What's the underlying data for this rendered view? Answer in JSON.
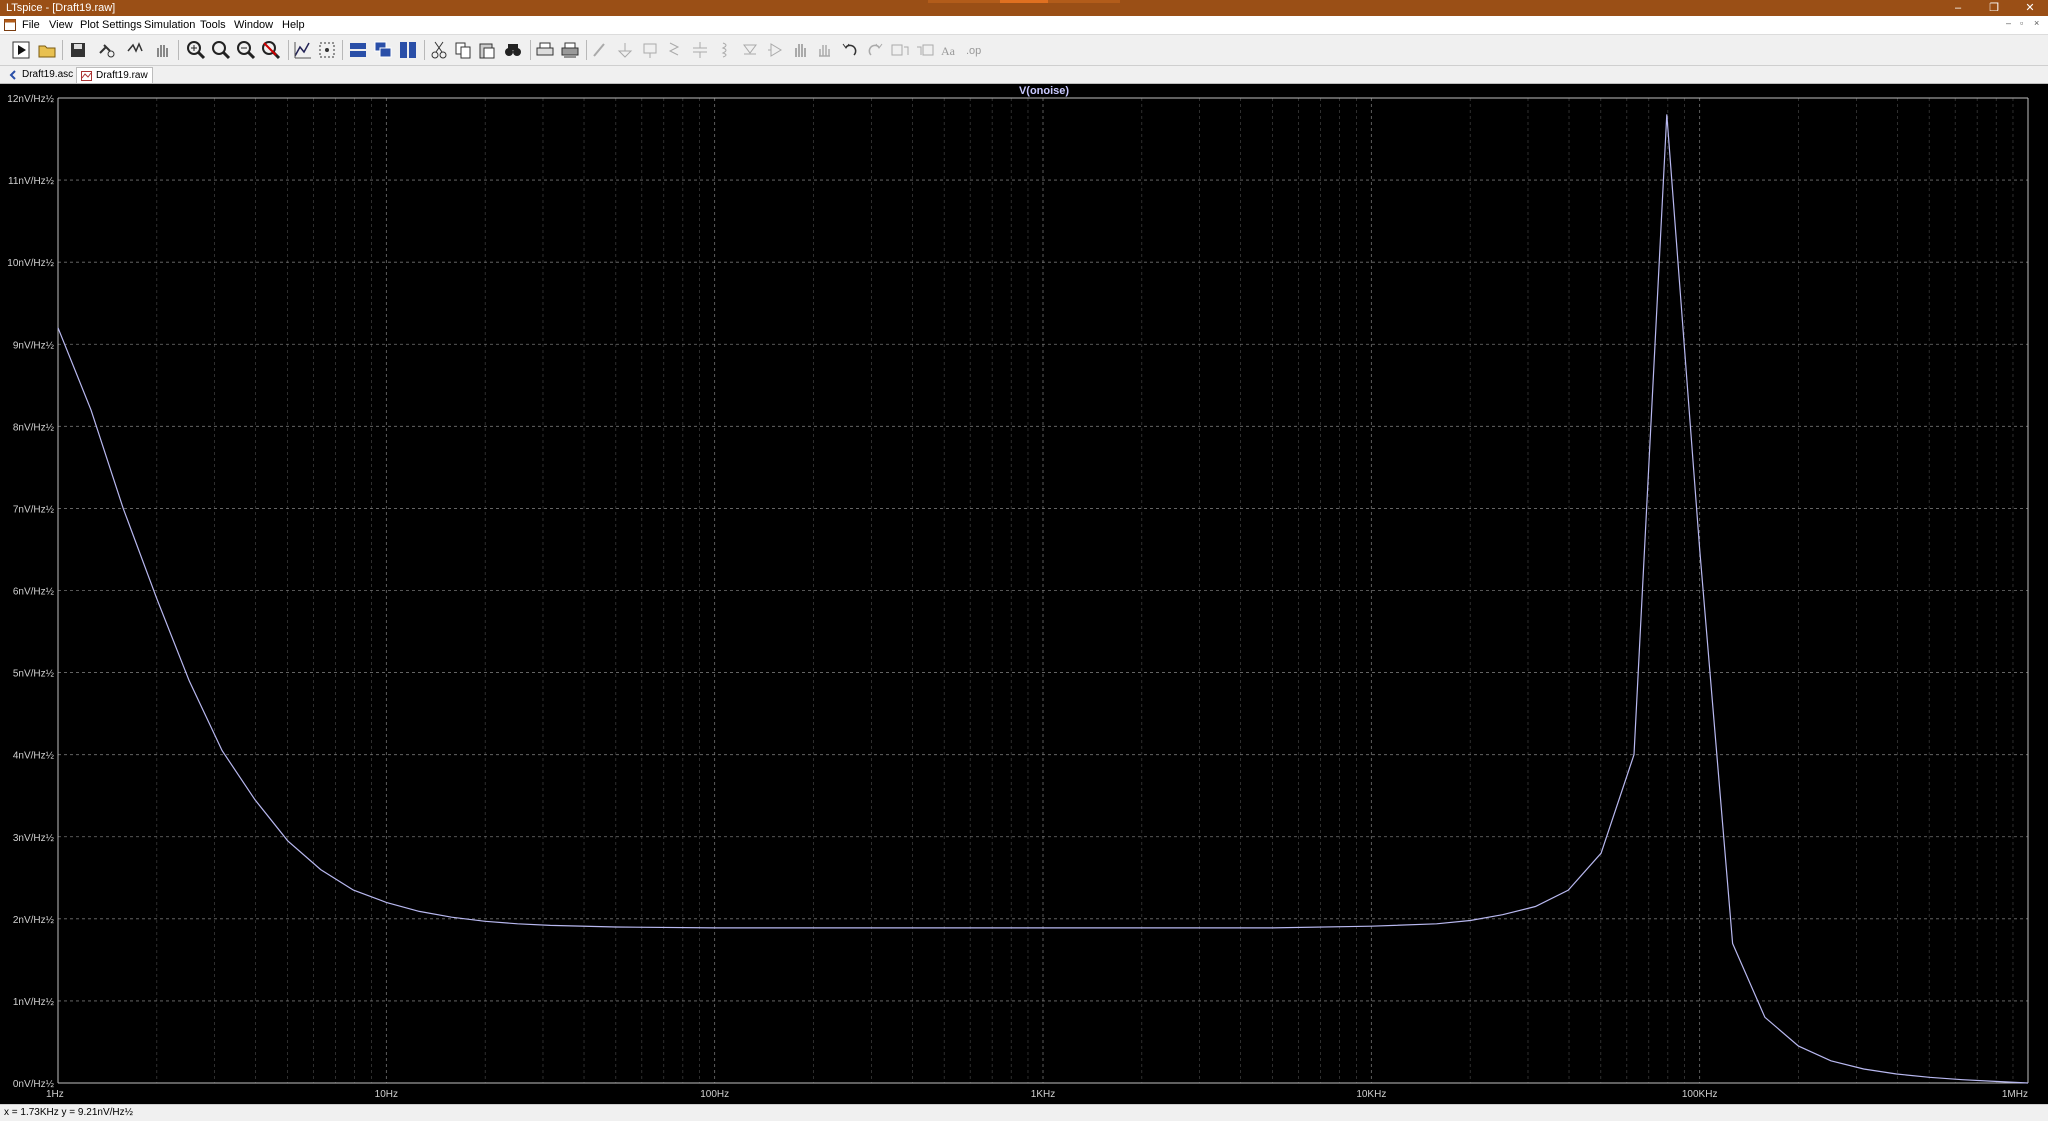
{
  "window": {
    "title": "LTspice - [Draft19.raw]",
    "controls": [
      "–",
      "❐",
      "✕"
    ]
  },
  "menu": {
    "items": [
      "File",
      "View",
      "Plot Settings",
      "Simulation",
      "Tools",
      "Window",
      "Help"
    ]
  },
  "tabs": [
    {
      "label": "Draft19.asc",
      "icon": "schematic-icon"
    },
    {
      "label": "Draft19.raw",
      "icon": "waveform-icon"
    }
  ],
  "plot": {
    "trace_label": "V(onoise)",
    "trace_color": "#b8b8f0",
    "background": "#000000",
    "grid_color": "#808080"
  },
  "status": {
    "readout": "x = 1.73KHz  y = 9.21nV/Hz½"
  },
  "chart_data": {
    "type": "line",
    "title": "V(onoise)",
    "xscale": "log",
    "xlim": [
      1,
      1000000
    ],
    "ylim": [
      0,
      12
    ],
    "grid": true,
    "x_ticks": [
      "1Hz",
      "10Hz",
      "100Hz",
      "1KHz",
      "10KHz",
      "100KHz",
      "1MHz"
    ],
    "y_ticks": [
      "0nV/Hz½",
      "1nV/Hz½",
      "2nV/Hz½",
      "3nV/Hz½",
      "4nV/Hz½",
      "5nV/Hz½",
      "6nV/Hz½",
      "7nV/Hz½",
      "8nV/Hz½",
      "9nV/Hz½",
      "10nV/Hz½",
      "11nV/Hz½",
      "12nV/Hz½"
    ],
    "series": [
      {
        "name": "V(onoise)",
        "x": [
          1,
          1.26,
          1.58,
          2,
          2.51,
          3.16,
          3.98,
          5.01,
          6.31,
          7.94,
          10,
          12.6,
          15.8,
          20,
          25.1,
          31.6,
          50,
          100,
          1000,
          5000,
          10000,
          15800,
          20000,
          25100,
          31600,
          39800,
          50100,
          63100,
          79400,
          100000,
          126000,
          158000,
          200000,
          251000,
          316000,
          398000,
          501000,
          631000,
          794000,
          1000000
        ],
        "y": [
          9.2,
          8.2,
          7.0,
          5.9,
          4.9,
          4.05,
          3.45,
          2.95,
          2.6,
          2.35,
          2.2,
          2.09,
          2.02,
          1.97,
          1.94,
          1.92,
          1.9,
          1.89,
          1.89,
          1.89,
          1.91,
          1.94,
          1.98,
          2.05,
          2.15,
          2.35,
          2.8,
          4.0,
          11.8,
          6.5,
          1.7,
          0.8,
          0.45,
          0.27,
          0.17,
          0.11,
          0.07,
          0.04,
          0.02,
          0.0
        ]
      }
    ]
  }
}
